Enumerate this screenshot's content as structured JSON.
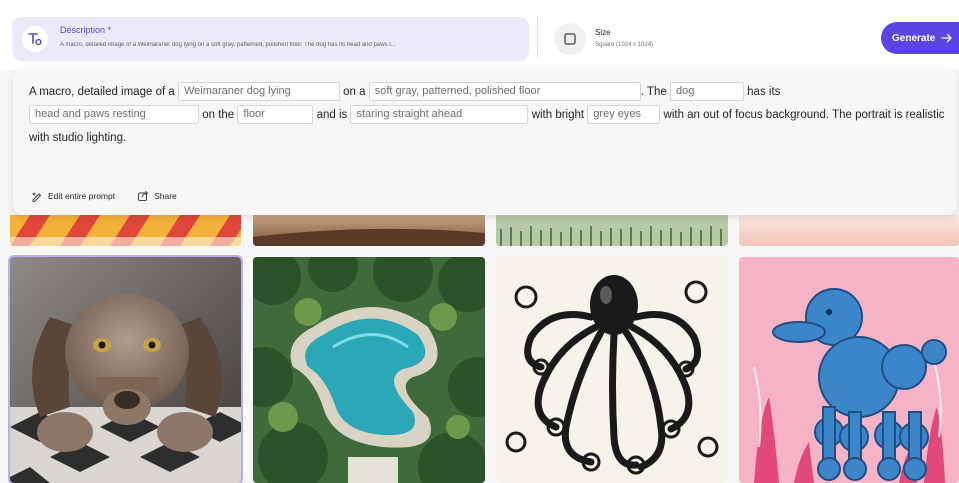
{
  "description": {
    "title": "Description *",
    "summary": "A macro, detailed image of a Weimaraner dog lying on a soft gray, patterned, polished floor. The dog has its head and paws r...",
    "icon": "text-t-icon"
  },
  "size": {
    "title": "Size",
    "value": "Square (1024 x 1024)",
    "icon": "square-icon"
  },
  "generate": {
    "label": "Generate",
    "icon": "arrow-right-icon",
    "color": "#5b44e5"
  },
  "prompt": {
    "t1": "A macro, detailed image of a",
    "s1": "Weimaraner dog lying",
    "t2": "on a",
    "s2": "soft gray, patterned, polished floor",
    "t3": ". The",
    "s3": "dog",
    "t4": "has its",
    "s4": "head and paws resting",
    "t5": "on the",
    "s5": "floor",
    "t6": "and is",
    "s6": "staring straight ahead",
    "t7": "with bright",
    "s7": "grey eyes",
    "t8": "with an out of focus background. The portrait is realistic with studio lighting."
  },
  "actions": {
    "edit_label": "Edit entire prompt",
    "share_label": "Share"
  },
  "accent": "#5b3fd6"
}
